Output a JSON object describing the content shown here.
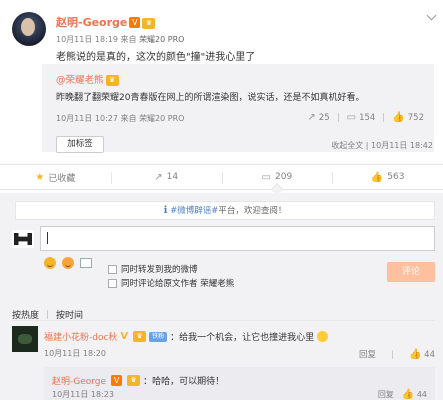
{
  "post": {
    "author": "赵明-George",
    "badge_v": "V",
    "badge_m": "5",
    "time": "10月11日 18:19",
    "from_label": "来自",
    "source": "荣耀20 PRO",
    "text": "老熊说的是真的，这次的颜色\"撞\"进我心里了"
  },
  "repost": {
    "author": "@荣耀老熊",
    "badge_m": "5",
    "text": "昨晚翻了翻荣耀20青春版在网上的所谓渲染图，说实话，还是不如真机好看。",
    "time": "10月11日 10:27",
    "from_label": "来自",
    "source": "荣耀20 PRO",
    "stats": {
      "forward": "25",
      "comment": "154",
      "like": "752"
    },
    "footer": "收起全文 | 10月11日 18:42"
  },
  "tag_button": "加标签",
  "actions": {
    "favorite": "已收藏",
    "forward": "14",
    "comment": "209",
    "like": "563"
  },
  "comment_box": {
    "notice_prefix": "#微博辟谣#",
    "notice_suffix": "平台，欢迎查阅！",
    "input_value": "",
    "checkbox_forward": "同时转发到我的微博",
    "checkbox_author": "同时评论给原文作者 荣耀老熊",
    "submit": "评论"
  },
  "sort": {
    "hot": "按热度",
    "time": "按时间"
  },
  "comments": [
    {
      "user": "福建小花粉-doc秋",
      "badge_fan": "铁粉",
      "text": "：给我一个机会，让它也撞进我心里",
      "time": "10月11日 18:20",
      "reply": "回复",
      "likes": "44"
    }
  ],
  "replies": [
    {
      "user": "赵明-George",
      "text": "：哈哈，可以期待！",
      "time": "10月11日 18:23",
      "reply": "回复",
      "likes": "44"
    }
  ]
}
